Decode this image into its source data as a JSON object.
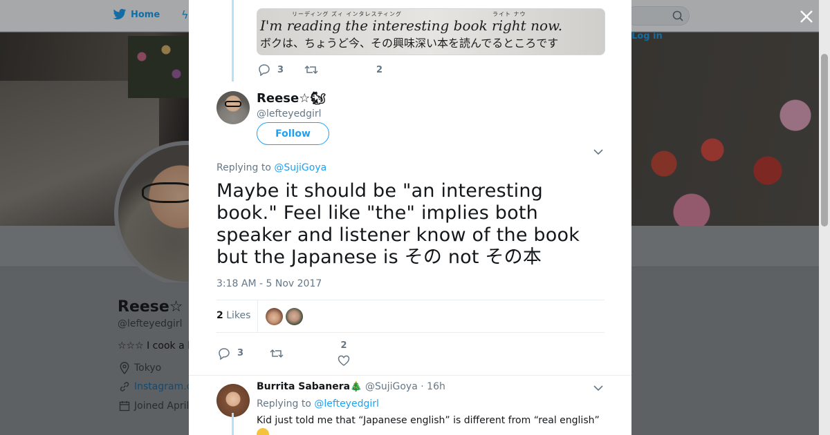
{
  "background": {
    "nav": {
      "home_label": "Home",
      "login_label": "Log in"
    },
    "profile": {
      "name": "Reese☆",
      "handle": "@lefteyedgirl",
      "bio": "☆☆☆ I cook a l",
      "location": "Tokyo",
      "website": "Instagram.c",
      "joined": "Joined April"
    }
  },
  "modal": {
    "parent_media": {
      "english_text": "I'm reading the interesting book right now.",
      "japanese_text": "ボクは、ちょうど今、その興味深い本を読んでるところです",
      "ruby_left": "リーディング ズィ インタレスティング",
      "ruby_right": "ライト ナウ"
    },
    "parent_actions": {
      "replies": "3",
      "likes": "2"
    },
    "tweet": {
      "author_name": "Reese☆🐿",
      "author_handle": "@lefteyedgirl",
      "follow_label": "Follow",
      "replying_prefix": "Replying to",
      "replying_handle": "@SujiGoya",
      "text": "Maybe it should be \"an interesting book.\" Feel like \"the\" implies both speaker and listener know of the book but the Japanese is その not その本",
      "timestamp": "3:18 AM - 5 Nov 2017",
      "likes_count": "2",
      "likes_label": "Likes",
      "replies": "3",
      "likes_action": "2"
    },
    "reply": {
      "author_name": "Burrita Sabanera🎄",
      "author_handle": "@SujiGoya",
      "time": "16h",
      "replying_prefix": "Replying to",
      "replying_handle": "@lefteyedgirl",
      "text": "Kid just told me that “Japanese english” is different from “real english”"
    }
  },
  "colors": {
    "accent": "#1da1f2",
    "muted": "#657786",
    "text": "#14171a",
    "thread": "#b6e0f7"
  }
}
